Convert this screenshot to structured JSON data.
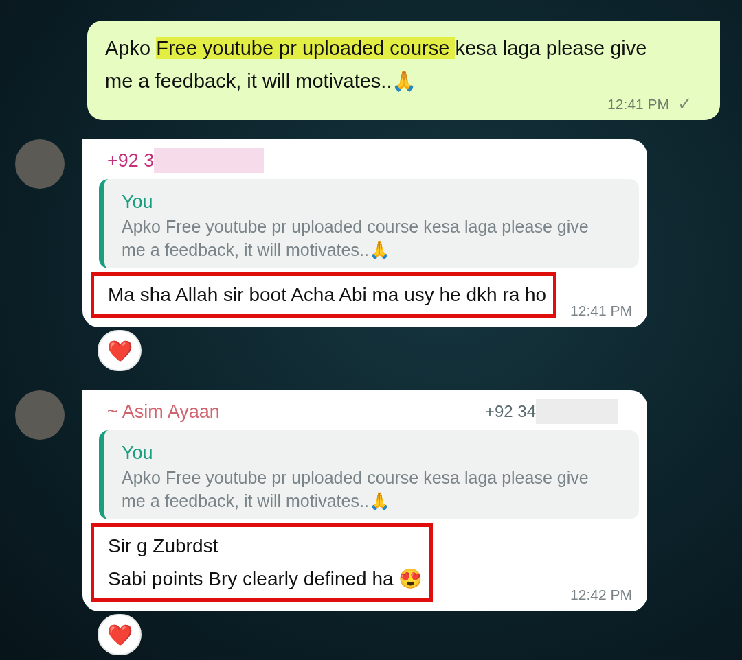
{
  "outgoing": {
    "segments": [
      {
        "text": "Apko ",
        "highlighted": false
      },
      {
        "text": "Free youtube pr uploaded course ",
        "highlighted": true
      },
      {
        "text": "kesa laga please give me a feedback, it will motivates..🙏",
        "highlighted": false
      }
    ],
    "time": "12:41 PM",
    "ticks": "✓"
  },
  "messages": [
    {
      "sender": "+92 3",
      "color": "#c4307a",
      "sender_redacted": true,
      "quote": {
        "author": "You",
        "text": "Apko Free youtube pr uploaded course kesa laga please give me a feedback, it will motivates..🙏"
      },
      "lines": [
        "Ma sha Allah sir boot Acha Abi ma usy he dkh ra ho"
      ],
      "annotated": true,
      "time": "12:41 PM",
      "reaction": "❤️"
    },
    {
      "sender": "~ Asim Ayaan",
      "color": "#d0636e",
      "phone": "+92 34",
      "phone_redacted": true,
      "quote": {
        "author": "You",
        "text": "Apko Free youtube pr uploaded course kesa laga please give me a feedback, it will motivates..🙏"
      },
      "lines": [
        "Sir g Zubrdst",
        "Sabi points Bry clearly defined ha 😍"
      ],
      "annotated": true,
      "time": "12:42 PM",
      "reaction": "❤️"
    }
  ]
}
